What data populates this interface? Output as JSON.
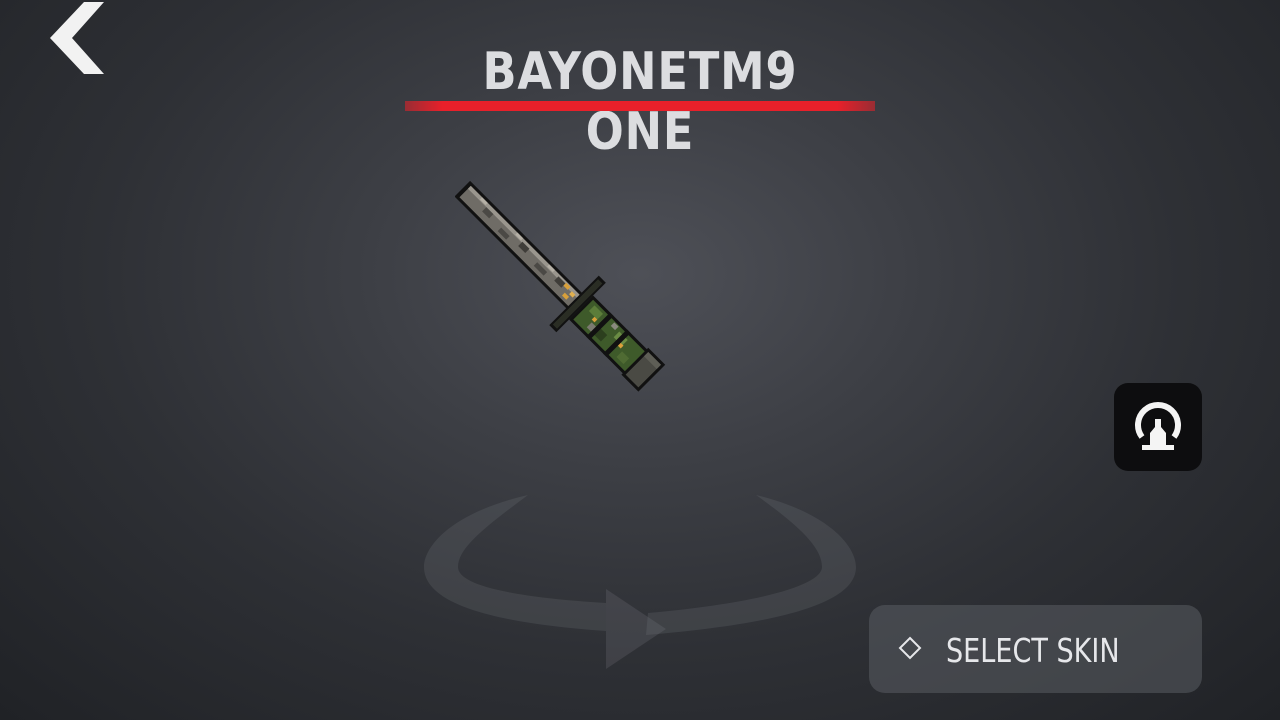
{
  "header": {
    "title": "BAYONETM9 ONE",
    "underline_color": "#e8202a"
  },
  "icons": {
    "back": "back-chevron-icon",
    "camera": "view-camera-icon",
    "rotate": "rotate-arrow-icon",
    "select": "diamond-icon"
  },
  "actions": {
    "select_skin_label": "SELECT SKIN"
  },
  "colors": {
    "background": "#3a3c42",
    "accent": "#e8202a",
    "button_bg": "#0d0d0f"
  }
}
